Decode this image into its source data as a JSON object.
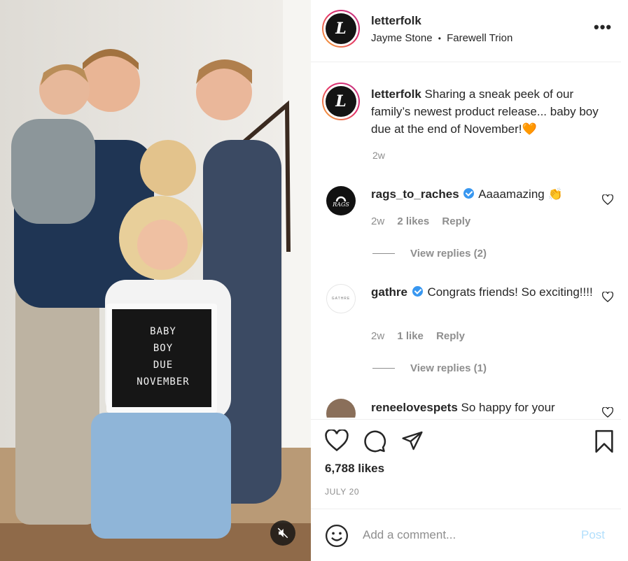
{
  "media": {
    "letterboard_lines": [
      "BABY",
      "BOY",
      "DUE",
      "NOVEMBER"
    ],
    "mute_icon": "speaker-muted-icon"
  },
  "header": {
    "avatar_letter": "L",
    "username": "letterfolk",
    "subtitle_left": "Jayme Stone",
    "subtitle_sep": "•",
    "subtitle_right": "Farewell Trion",
    "more_label": "•••"
  },
  "caption": {
    "username": "letterfolk",
    "text": "Sharing a sneak peek of our family’s newest product release... baby boy due at the end of November!",
    "emoji": "🧡",
    "time": "2w"
  },
  "comments": [
    {
      "username": "rags_to_raches",
      "avatar_text": "RAGS",
      "text": "Aaaamazing",
      "emoji": "👏",
      "time": "2w",
      "likes": "2 likes",
      "reply": "Reply",
      "view_replies": "View replies (2)"
    },
    {
      "username": "gathre",
      "avatar_text": "GATHRE",
      "text": "Congrats friends! So exciting!!!!",
      "time": "2w",
      "likes": "1 like",
      "reply": "Reply",
      "view_replies": "View replies (1)"
    },
    {
      "username": "reneelovespets",
      "text": "So happy for your"
    }
  ],
  "footer": {
    "likes": "6,788 likes",
    "date": "JULY 20",
    "comment_placeholder": "Add a comment...",
    "post_label": "Post"
  },
  "colors": {
    "verified": "#3897f0",
    "muted_text": "#8e8e8e",
    "post_disabled": "#b2dffc",
    "ring_gradient": [
      "#f8b133",
      "#e1306c",
      "#c13584"
    ]
  }
}
